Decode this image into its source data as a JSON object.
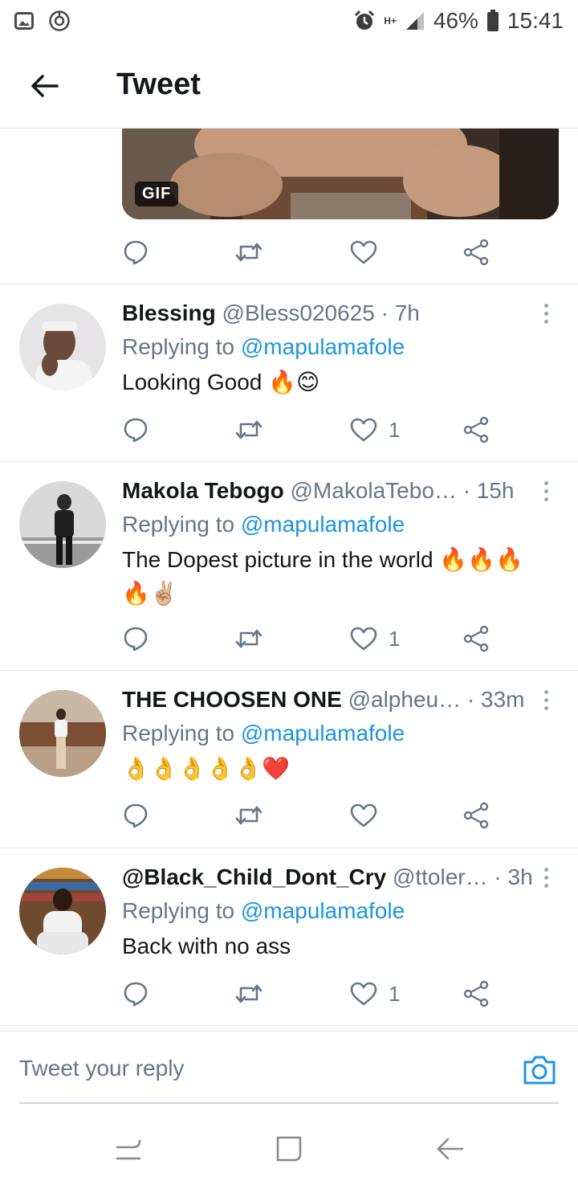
{
  "status_bar": {
    "network_type": "H+",
    "battery_percent": "46%",
    "time": "15:41"
  },
  "header": {
    "title": "Tweet"
  },
  "gif_preview": {
    "badge": "GIF"
  },
  "tweets": [
    {
      "name": "Blessing",
      "handle": "@Bless020625",
      "time": "· 7h",
      "replying_prefix": "Replying to",
      "replying_to": "@mapulamafole",
      "text": "Looking Good 🔥😊",
      "like_count": "1"
    },
    {
      "name": "Makola Tebogo",
      "handle": "@MakolaTebo…",
      "time": "· 15h",
      "replying_prefix": "Replying to",
      "replying_to": "@mapulamafole",
      "text": "The Dopest picture in the world 🔥🔥🔥 🔥✌🏼",
      "like_count": "1"
    },
    {
      "name": "THE CHOOSEN ONE",
      "handle": "@alpheu…",
      "time": "· 33m",
      "replying_prefix": "Replying to",
      "replying_to": "@mapulamafole",
      "text": "👌👌👌👌👌❤️",
      "like_count": ""
    },
    {
      "name": "@Black_Child_Dont_Cry",
      "handle": "@ttoler…",
      "time": "· 3h",
      "replying_prefix": "Replying to",
      "replying_to": "@mapulamafole",
      "text": "Back with no ass",
      "like_count": "1"
    }
  ],
  "compose": {
    "placeholder": "Tweet your reply"
  },
  "colors": {
    "accent": "#1b95e0",
    "muted": "#657786",
    "divider": "#e1e8ed"
  },
  "icons": [
    "gallery-icon",
    "location-icon",
    "alarm-icon",
    "signal-icon",
    "battery-icon",
    "back-arrow-icon",
    "reply-icon",
    "retweet-icon",
    "like-icon",
    "share-icon",
    "more-icon",
    "camera-icon",
    "recents-icon",
    "home-icon",
    "nav-back-icon"
  ]
}
